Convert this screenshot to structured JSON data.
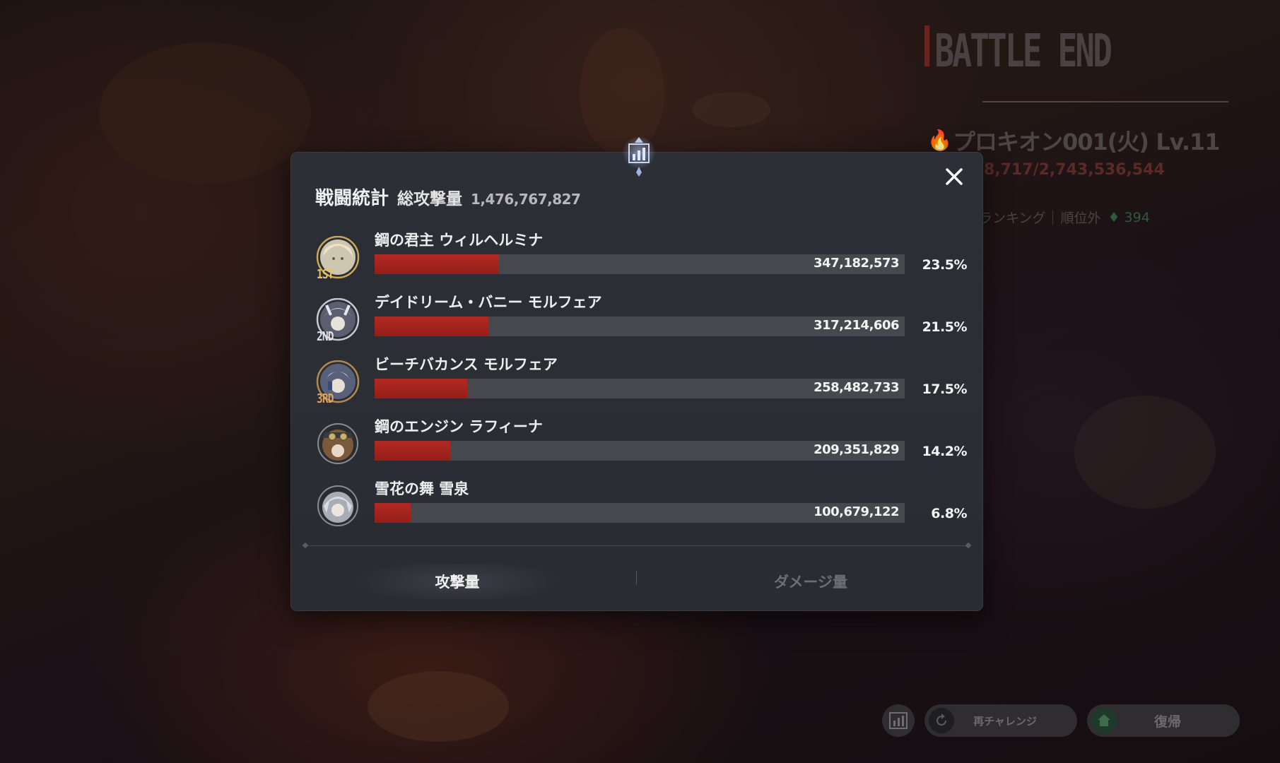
{
  "header": {
    "battle_end": "BATTLE END",
    "boss_name": "プロキオン001(火) Lv.11",
    "boss_hp": "8,717/2,743,536,544",
    "ranking_label": "ランキング",
    "ranking_status": "順位外",
    "ranking_change": "♦ 394"
  },
  "modal": {
    "title": "戦闘統計",
    "total_label": "総攻撃量",
    "total_value": "1,476,767,827",
    "rows": [
      {
        "rank": "1ST",
        "name": "鋼の君主 ウィルヘルミナ",
        "value": "347,182,573",
        "percent": "23.5%",
        "ratio": 0.235
      },
      {
        "rank": "2ND",
        "name": "デイドリーム・バニー モルフェア",
        "value": "317,214,606",
        "percent": "21.5%",
        "ratio": 0.215
      },
      {
        "rank": "3RD",
        "name": "ビーチバカンス モルフェア",
        "value": "258,482,733",
        "percent": "17.5%",
        "ratio": 0.175
      },
      {
        "rank": "",
        "name": "鋼のエンジン ラフィーナ",
        "value": "209,351,829",
        "percent": "14.2%",
        "ratio": 0.142
      },
      {
        "rank": "",
        "name": "雪花の舞 雪泉",
        "value": "100,679,122",
        "percent": "6.8%",
        "ratio": 0.068
      }
    ],
    "tabs": {
      "attack": "攻撃量",
      "damage": "ダメージ量"
    }
  },
  "buttons": {
    "retry": "再チャレンジ",
    "return": "復帰"
  },
  "colors": {
    "bar_fill": "#b22a22",
    "rank_gold": "#e8c45a",
    "rank_silver": "#e0e0e6",
    "rank_bronze": "#d9a25a"
  }
}
